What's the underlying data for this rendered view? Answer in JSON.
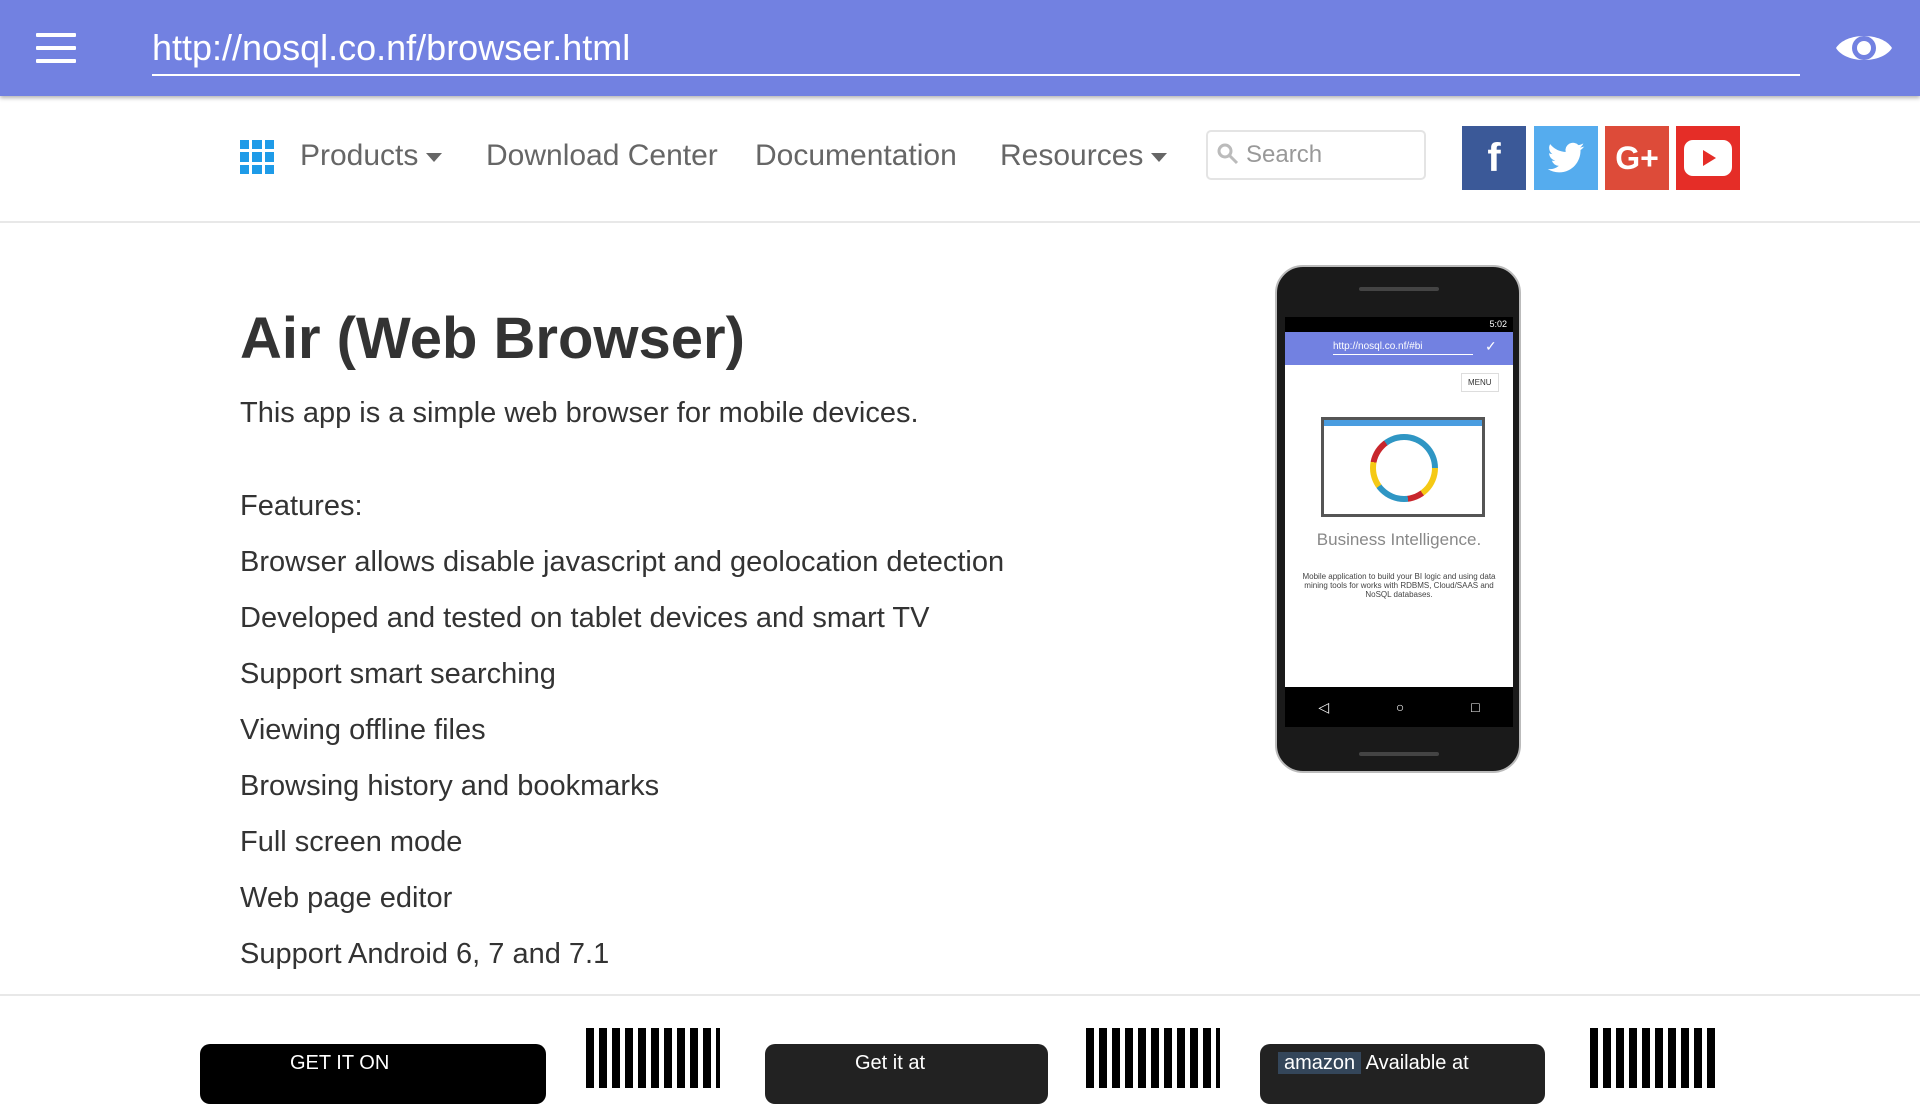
{
  "browser": {
    "url": "http://nosql.co.nf/browser.html",
    "menu_icon": "hamburger-icon",
    "view_icon": "eye-icon",
    "accent": "#7281e1"
  },
  "nav": {
    "products": "Products",
    "download_center": "Download Center",
    "documentation": "Documentation",
    "resources": "Resources",
    "search_placeholder": "Search",
    "social": [
      {
        "name": "facebook",
        "glyph": "f",
        "color": "#3b5998"
      },
      {
        "name": "twitter",
        "glyph": "t",
        "color": "#55acee"
      },
      {
        "name": "google-plus",
        "glyph": "G+",
        "color": "#dd4b39"
      },
      {
        "name": "youtube",
        "glyph": "▶",
        "color": "#e52d27"
      }
    ]
  },
  "main": {
    "title": "Air (Web Browser)",
    "subtitle": "This app is a simple web browser for mobile devices.",
    "features_label": "Features:",
    "features": [
      "Browser allows disable javascript and geolocation detection",
      "Developed and tested on tablet devices and smart TV",
      "Support smart searching",
      "Viewing offline files",
      "Browsing history and bookmarks",
      "Full screen mode",
      "Web page editor",
      "Support Android 6, 7 and 7.1"
    ]
  },
  "phone": {
    "time": "5:02",
    "url": "http://nosql.co.nf/#bi",
    "menu": "MENU",
    "heading": "Business Intelligence.",
    "desc": "Mobile application to build your BI logic and using data mining tools for works with RDBMS, Cloud/SAAS and NoSQL databases."
  },
  "stores": {
    "google": "GET IT ON",
    "blackberry": "Get it at",
    "amazon": "amazon",
    "amazon_text": "Available at"
  }
}
